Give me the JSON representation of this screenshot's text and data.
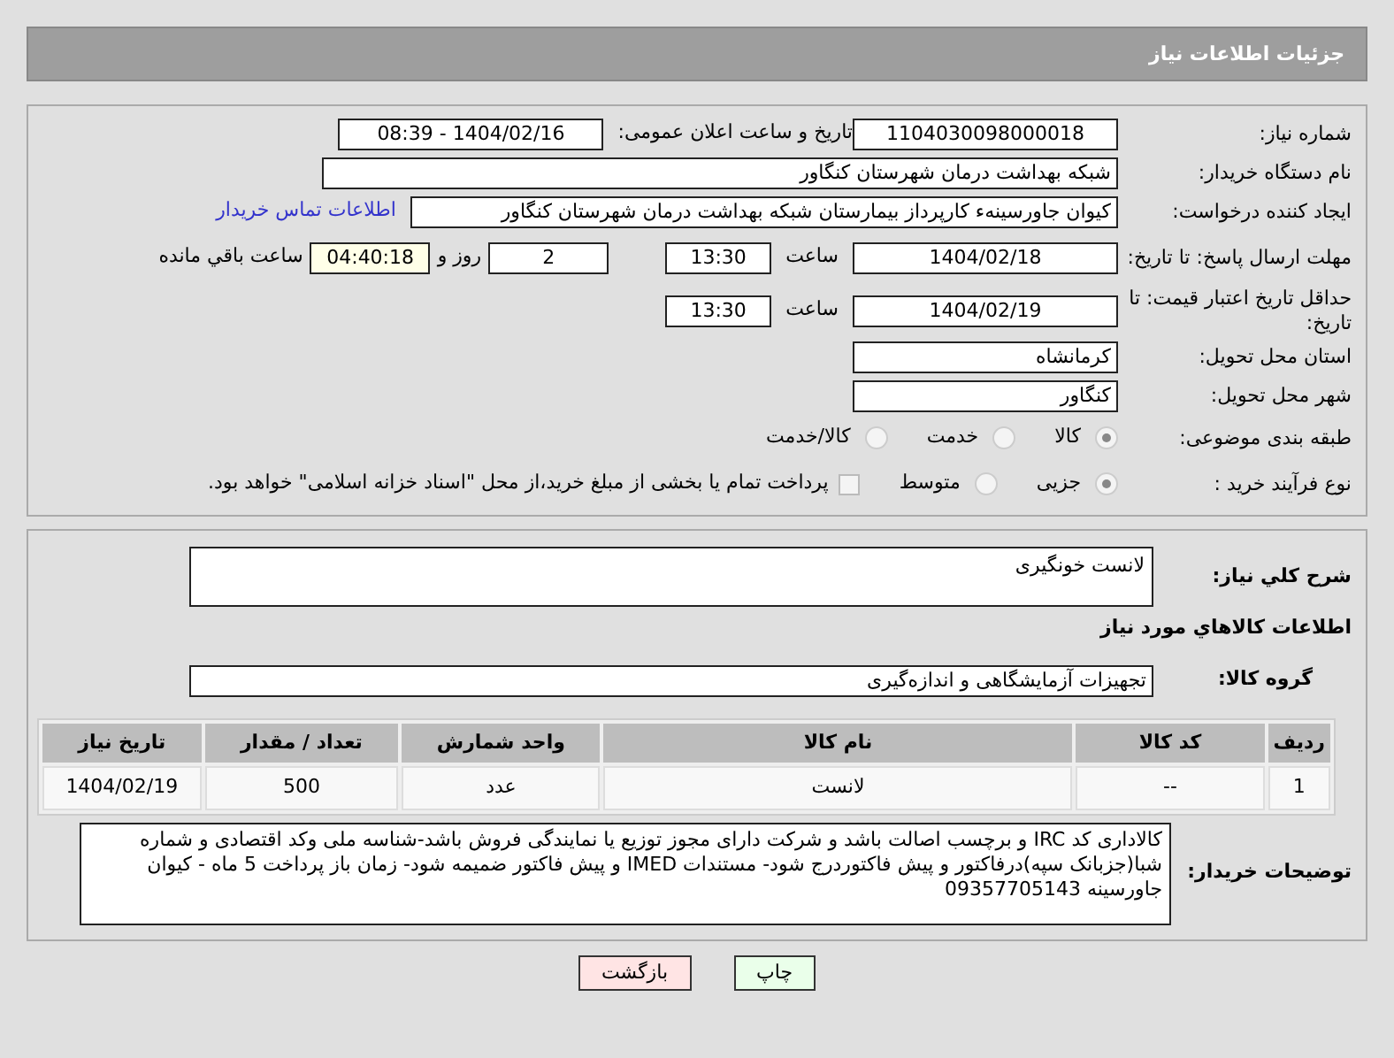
{
  "header": {
    "title": "جزئیات اطلاعات نیاز"
  },
  "need_number": {
    "label": "شماره نیاز:",
    "value": "1104030098000018"
  },
  "announce": {
    "label": "تاریخ و ساعت اعلان عمومی:",
    "value": "1404/02/16 - 08:39"
  },
  "buyer": {
    "label": "نام دستگاه خریدار:",
    "value": "شبکه بهداشت درمان شهرستان کنگاور"
  },
  "creator": {
    "label": "ایجاد کننده درخواست:",
    "value": "کیوان جاورسینهء کارپرداز بیمارستان شبکه بهداشت درمان شهرستان کنگاور",
    "link": "اطلاعات تماس خریدار"
  },
  "deadline": {
    "label": "مهلت ارسال پاسخ: تا تاریخ:",
    "date": "1404/02/18",
    "time_label": "ساعت",
    "time": "13:30",
    "days": "2",
    "days_label": "روز و",
    "remaining": "04:40:18",
    "remaining_label": "ساعت باقي مانده"
  },
  "validity": {
    "label": "حداقل تاریخ اعتبار قیمت: تا تاریخ:",
    "date": "1404/02/19",
    "time_label": "ساعت",
    "time": "13:30"
  },
  "province": {
    "label": "استان محل تحویل:",
    "value": "کرمانشاه"
  },
  "city": {
    "label": "شهر محل تحویل:",
    "value": "کنگاور"
  },
  "category": {
    "label": "طبقه بندی موضوعی:",
    "options": [
      {
        "label": "کالا",
        "selected": true
      },
      {
        "label": "خدمت",
        "selected": false
      },
      {
        "label": "کالا/خدمت",
        "selected": false
      }
    ]
  },
  "process": {
    "label": "نوع فرآیند خرید :",
    "options": [
      {
        "label": "جزیی",
        "selected": true
      },
      {
        "label": "متوسط",
        "selected": false
      }
    ],
    "payment": {
      "label": "پرداخت تمام یا بخشی از مبلغ خرید،از محل \"اسناد خزانه اسلامی\" خواهد بود.",
      "checked": false
    }
  },
  "description": {
    "label": "شرح کلي نياز:",
    "value": "لانست خونگیری"
  },
  "items_heading": "اطلاعات کالاهاي مورد نياز",
  "group": {
    "label": "گروه کالا:",
    "value": "تجهیزات آزمایشگاهی و اندازه‌گیری"
  },
  "table": {
    "columns": [
      "ردیف",
      "کد کالا",
      "نام کالا",
      "واحد شمارش",
      "تعداد / مقدار",
      "تاریخ نیاز"
    ],
    "rows": [
      [
        "1",
        "--",
        "لانست",
        "عدد",
        "500",
        "1404/02/19"
      ]
    ]
  },
  "notes": {
    "label": "توضیحات خریدار:",
    "value": "کالاداری کد IRC و برچسب اصالت باشد و شرکت دارای مجوز توزیع یا نمایندگی فروش باشد-شناسه ملی وکد اقتصادی و شماره شبا(جزبانک سپه)درفاکتور و پیش فاکتوردرج شود- مستندات IMED و پیش فاکتور ضمیمه شود- زمان باز پرداخت  5 ماه - کیوان جاورسینه 09357705143"
  },
  "buttons": [
    {
      "label": "چاپ",
      "kind": "print"
    },
    {
      "label": "بازگشت",
      "kind": "back"
    }
  ]
}
